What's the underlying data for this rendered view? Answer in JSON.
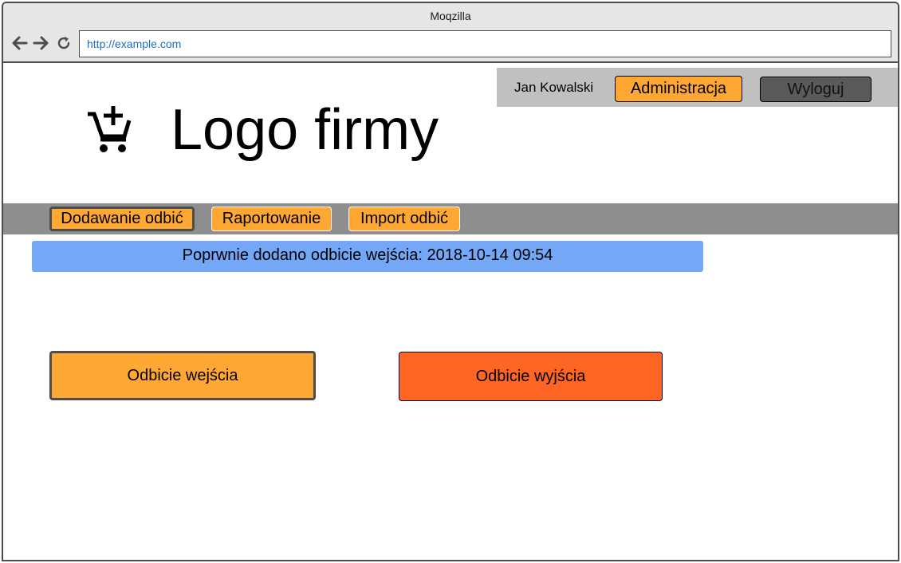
{
  "window": {
    "title": "Moqzilla"
  },
  "browser": {
    "url": "http://example.com",
    "back_icon": "arrow-left-icon",
    "forward_icon": "arrow-right-icon",
    "reload_icon": "reload-icon"
  },
  "header": {
    "user_name": "Jan Kowalski",
    "admin_label": "Administracja",
    "logout_label": "Wyloguj",
    "logo_icon": "cart-plus-icon",
    "logo_text": "Logo firmy"
  },
  "menu": {
    "tabs": [
      {
        "label": "Dodawanie odbić",
        "active": true
      },
      {
        "label": "Raportowanie",
        "active": false
      },
      {
        "label": "Import odbić",
        "active": false
      }
    ]
  },
  "alert": {
    "message": "Poprwnie dodano odbicie wejścia: 2018-10-14 09:54"
  },
  "actions": {
    "entry_label": "Odbicie wejścia",
    "exit_label": "Odbicie wyjścia"
  },
  "colors": {
    "accent_orange": "#ffa733",
    "exit_orange": "#ff6624",
    "alert_blue": "#74a8f7",
    "menubar_gray": "#8e8e8e",
    "userbar_gray": "#c0c0c0"
  }
}
